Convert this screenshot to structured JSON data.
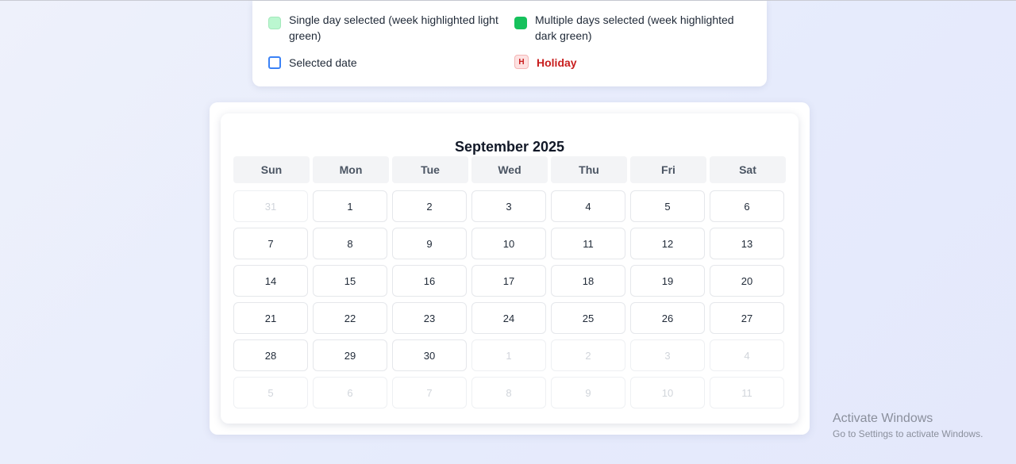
{
  "legend": {
    "single_day": "Single day selected (week highlighted light green)",
    "multiple_days": "Multiple days selected (week highlighted dark green)",
    "selected_date": "Selected date",
    "holiday_badge": "H",
    "holiday": "Holiday"
  },
  "calendar": {
    "title": "September 2025",
    "weekdays": [
      "Sun",
      "Mon",
      "Tue",
      "Wed",
      "Thu",
      "Fri",
      "Sat"
    ],
    "days": [
      {
        "label": "31",
        "in_month": false
      },
      {
        "label": "1",
        "in_month": true
      },
      {
        "label": "2",
        "in_month": true
      },
      {
        "label": "3",
        "in_month": true
      },
      {
        "label": "4",
        "in_month": true
      },
      {
        "label": "5",
        "in_month": true
      },
      {
        "label": "6",
        "in_month": true
      },
      {
        "label": "7",
        "in_month": true
      },
      {
        "label": "8",
        "in_month": true
      },
      {
        "label": "9",
        "in_month": true
      },
      {
        "label": "10",
        "in_month": true
      },
      {
        "label": "11",
        "in_month": true
      },
      {
        "label": "12",
        "in_month": true
      },
      {
        "label": "13",
        "in_month": true
      },
      {
        "label": "14",
        "in_month": true
      },
      {
        "label": "15",
        "in_month": true
      },
      {
        "label": "16",
        "in_month": true
      },
      {
        "label": "17",
        "in_month": true
      },
      {
        "label": "18",
        "in_month": true
      },
      {
        "label": "19",
        "in_month": true
      },
      {
        "label": "20",
        "in_month": true
      },
      {
        "label": "21",
        "in_month": true
      },
      {
        "label": "22",
        "in_month": true
      },
      {
        "label": "23",
        "in_month": true
      },
      {
        "label": "24",
        "in_month": true
      },
      {
        "label": "25",
        "in_month": true
      },
      {
        "label": "26",
        "in_month": true
      },
      {
        "label": "27",
        "in_month": true
      },
      {
        "label": "28",
        "in_month": true
      },
      {
        "label": "29",
        "in_month": true
      },
      {
        "label": "30",
        "in_month": true
      },
      {
        "label": "1",
        "in_month": false
      },
      {
        "label": "2",
        "in_month": false
      },
      {
        "label": "3",
        "in_month": false
      },
      {
        "label": "4",
        "in_month": false
      },
      {
        "label": "5",
        "in_month": false
      },
      {
        "label": "6",
        "in_month": false
      },
      {
        "label": "7",
        "in_month": false
      },
      {
        "label": "8",
        "in_month": false
      },
      {
        "label": "9",
        "in_month": false
      },
      {
        "label": "10",
        "in_month": false
      },
      {
        "label": "11",
        "in_month": false
      }
    ]
  },
  "watermark": {
    "title": "Activate Windows",
    "subtitle": "Go to Settings to activate Windows."
  },
  "colors": {
    "single_day_swatch": "#bbf7d0",
    "multiple_days_swatch": "#16c15c",
    "selected_border": "#3b82f6",
    "holiday_text": "#c81e1e"
  }
}
